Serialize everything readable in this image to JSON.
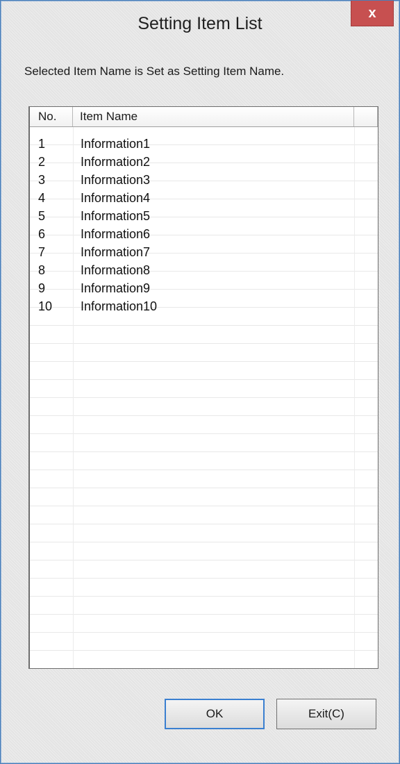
{
  "window": {
    "title": "Setting Item List",
    "close_label": "x"
  },
  "instruction": "Selected Item Name is Set as Setting Item Name.",
  "list": {
    "columns": [
      "No.",
      "Item Name"
    ],
    "rows": [
      {
        "no": "1",
        "name": "Information1"
      },
      {
        "no": "2",
        "name": "Information2"
      },
      {
        "no": "3",
        "name": "Information3"
      },
      {
        "no": "4",
        "name": "Information4"
      },
      {
        "no": "5",
        "name": "Information5"
      },
      {
        "no": "6",
        "name": "Information6"
      },
      {
        "no": "7",
        "name": "Information7"
      },
      {
        "no": "8",
        "name": "Information8"
      },
      {
        "no": "9",
        "name": "Information9"
      },
      {
        "no": "10",
        "name": "Information10"
      }
    ]
  },
  "buttons": {
    "ok_label": "OK",
    "exit_label": "Exit(C)"
  },
  "colors": {
    "close_button": "#c75050",
    "window_border": "#4a7fb8",
    "default_button_border": "#3a7fd0"
  }
}
